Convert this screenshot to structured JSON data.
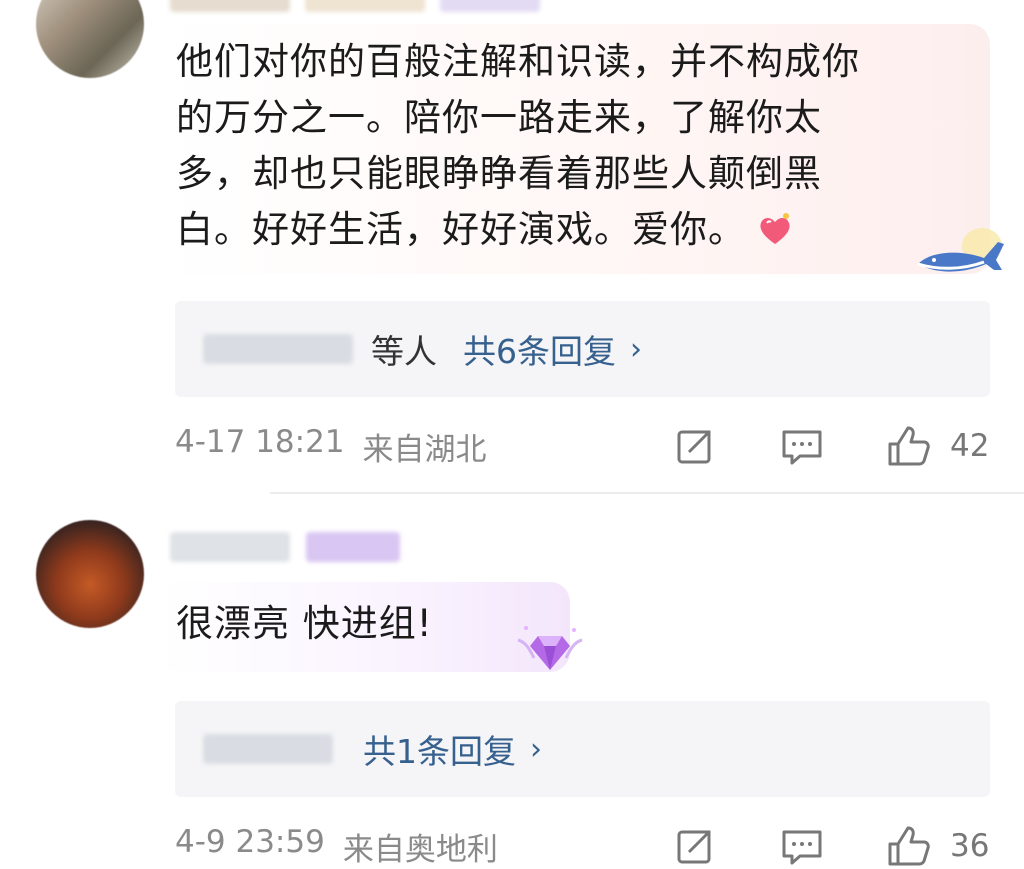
{
  "comments": [
    {
      "text": "他们对你的百般注解和识读，并不构成你的万分之一。陪你一路走来，了解你太多，却也只能眼睁睁看着那些人颠倒黑白。好好生活，好好演戏。爱你。",
      "lines": [
        "他们对你的百般注解和识读，并不构成你",
        "的万分之一。陪你一路走来，了解你太",
        "多，却也只能眼睁睁看着那些人颠倒黑",
        "白。好好生活，好好演戏。爱你。"
      ],
      "emoji": "heart-emoji",
      "decoration": "whale-icon",
      "replies": {
        "names_suffix": "等人",
        "count_label": "共6条回复",
        "chevron": "›"
      },
      "time": "4-17 18:21",
      "location": "来自湖北",
      "likes": "42"
    },
    {
      "text": "很漂亮 快进组!",
      "decoration": "diamond-badge-icon",
      "replies": {
        "count_label": "共1条回复",
        "chevron": "›"
      },
      "time": "4-9 23:59",
      "location": "来自奥地利",
      "likes": "36"
    }
  ],
  "colors": {
    "link": "#36608e",
    "meta": "#8a8a8a",
    "reply_bg": "#f5f5f7"
  }
}
